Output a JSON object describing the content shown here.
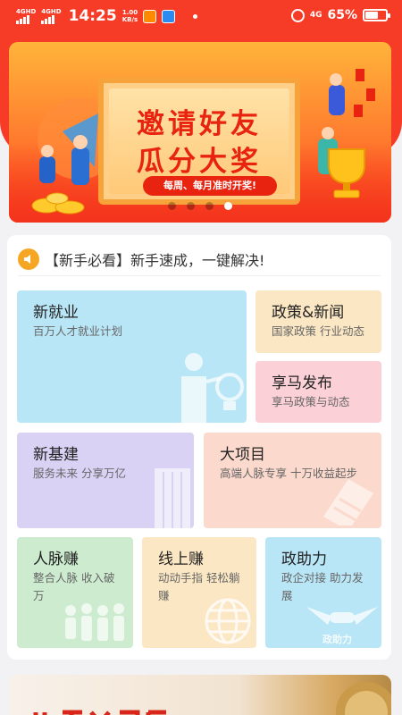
{
  "status_bar": {
    "signal1": "4GHD",
    "signal2": "4GHD",
    "time": "14:25",
    "speed_value": "1.00",
    "speed_unit": "KB/s",
    "network": "4G",
    "battery_percent": "65%",
    "battery_level": 0.65
  },
  "banner": {
    "title_line1": "邀请好友",
    "title_line2": "瓜分大奖",
    "subtitle": "每周、每月准时开奖!",
    "page_count": 4,
    "active_page": 4
  },
  "notice": {
    "text": "【新手必看】新手速成，一键解决!"
  },
  "tiles": {
    "jiuye": {
      "title": "新就业",
      "subtitle": "百万人才就业计划"
    },
    "zhengce": {
      "title": "政策&新闻",
      "subtitle": "国家政策 行业动态"
    },
    "xiangma": {
      "title": "享马发布",
      "subtitle": "享马政策与动态"
    },
    "jijian": {
      "title": "新基建",
      "subtitle": "服务未来 分享万亿"
    },
    "xiangmu": {
      "title": "大项目",
      "subtitle": "高端人脉专享 十万收益起步"
    },
    "renmai": {
      "title": "人脉赚",
      "subtitle": "整合人脉 收入破万"
    },
    "xianshang": {
      "title": "线上赚",
      "subtitle": "动动手指 轻松躺赚"
    },
    "zhengzhu": {
      "title": "政助力",
      "subtitle": "政企对接 助力发展",
      "badge": "政助力"
    }
  },
  "colors": {
    "brand_red": "#f63b27",
    "tile_blue": "#b9e6f6",
    "tile_yellow": "#fbe7c3",
    "tile_pink": "#fbd0d7",
    "tile_purple": "#d9d2f4",
    "tile_salmon": "#fcd9cd",
    "tile_green": "#cdeccf"
  }
}
